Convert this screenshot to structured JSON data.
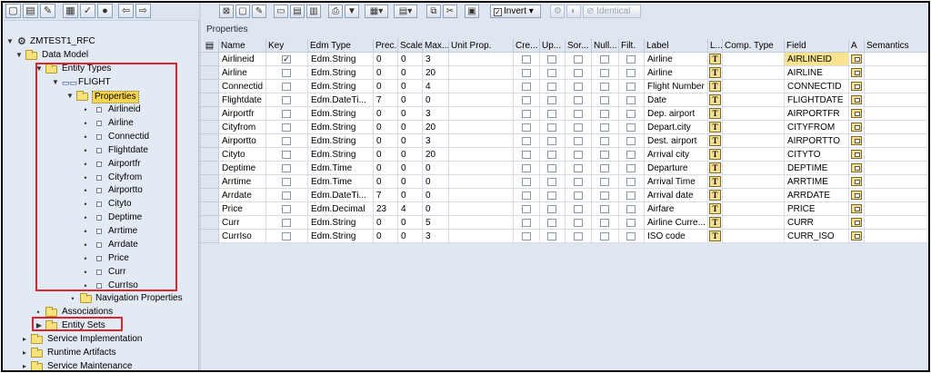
{
  "tree": {
    "root": "ZMTEST1_RFC",
    "data_model": "Data Model",
    "entity_types": "Entity Types",
    "flight": "FLIGHT",
    "properties": "Properties",
    "property_items": [
      "Airlineid",
      "Airline",
      "Connectid",
      "Flightdate",
      "Airportfr",
      "Cityfrom",
      "Airportto",
      "Cityto",
      "Deptime",
      "Arrtime",
      "Arrdate",
      "Price",
      "Curr",
      "CurrIso"
    ],
    "navigation_properties": "Navigation Properties",
    "associations": "Associations",
    "entity_sets": "Entity Sets",
    "service_implementation": "Service Implementation",
    "runtime_artifacts": "Runtime Artifacts",
    "service_maintenance": "Service Maintenance"
  },
  "toolbar": {
    "invert_label": "Invert",
    "identical_label": "Identical"
  },
  "section_title": "Properties",
  "columns": [
    "Name",
    "Key",
    "Edm Type",
    "Prec.",
    "Scale",
    "Max...",
    "Unit Prop.",
    "Cre...",
    "Up...",
    "Sor...",
    "Null...",
    "Filt.",
    "Label",
    "L...",
    "Comp. Type",
    "Field",
    "A",
    "Semantics"
  ],
  "rows": [
    {
      "name": "Airlineid",
      "key": true,
      "edm": "Edm.String",
      "prec": "0",
      "scale": "0",
      "max": "3",
      "label": "Airline",
      "field": "AIRLINEID"
    },
    {
      "name": "Airline",
      "key": false,
      "edm": "Edm.String",
      "prec": "0",
      "scale": "0",
      "max": "20",
      "label": "Airline",
      "field": "AIRLINE"
    },
    {
      "name": "Connectid",
      "key": false,
      "edm": "Edm.String",
      "prec": "0",
      "scale": "0",
      "max": "4",
      "label": "Flight Number",
      "field": "CONNECTID"
    },
    {
      "name": "Flightdate",
      "key": false,
      "edm": "Edm.DateTi...",
      "prec": "7",
      "scale": "0",
      "max": "0",
      "label": "Date",
      "field": "FLIGHTDATE"
    },
    {
      "name": "Airportfr",
      "key": false,
      "edm": "Edm.String",
      "prec": "0",
      "scale": "0",
      "max": "3",
      "label": "Dep. airport",
      "field": "AIRPORTFR"
    },
    {
      "name": "Cityfrom",
      "key": false,
      "edm": "Edm.String",
      "prec": "0",
      "scale": "0",
      "max": "20",
      "label": "Depart.city",
      "field": "CITYFROM"
    },
    {
      "name": "Airportto",
      "key": false,
      "edm": "Edm.String",
      "prec": "0",
      "scale": "0",
      "max": "3",
      "label": "Dest. airport",
      "field": "AIRPORTTO"
    },
    {
      "name": "Cityto",
      "key": false,
      "edm": "Edm.String",
      "prec": "0",
      "scale": "0",
      "max": "20",
      "label": "Arrival city",
      "field": "CITYTO"
    },
    {
      "name": "Deptime",
      "key": false,
      "edm": "Edm.Time",
      "prec": "0",
      "scale": "0",
      "max": "0",
      "label": "Departure",
      "field": "DEPTIME"
    },
    {
      "name": "Arrtime",
      "key": false,
      "edm": "Edm.Time",
      "prec": "0",
      "scale": "0",
      "max": "0",
      "label": "Arrival Time",
      "field": "ARRTIME"
    },
    {
      "name": "Arrdate",
      "key": false,
      "edm": "Edm.DateTi...",
      "prec": "7",
      "scale": "0",
      "max": "0",
      "label": "Arrival date",
      "field": "ARRDATE"
    },
    {
      "name": "Price",
      "key": false,
      "edm": "Edm.Decimal",
      "prec": "23",
      "scale": "4",
      "max": "0",
      "label": "Airfare",
      "field": "PRICE"
    },
    {
      "name": "Curr",
      "key": false,
      "edm": "Edm.String",
      "prec": "0",
      "scale": "0",
      "max": "5",
      "label": "Airline Curre...",
      "field": "CURR"
    },
    {
      "name": "CurrIso",
      "key": false,
      "edm": "Edm.String",
      "prec": "0",
      "scale": "0",
      "max": "3",
      "label": "ISO code",
      "field": "CURR_ISO"
    }
  ],
  "label_type_glyph": "T",
  "colors": {
    "highlight_box": "#d9262e",
    "selected_yellow": "#f7d44d"
  }
}
